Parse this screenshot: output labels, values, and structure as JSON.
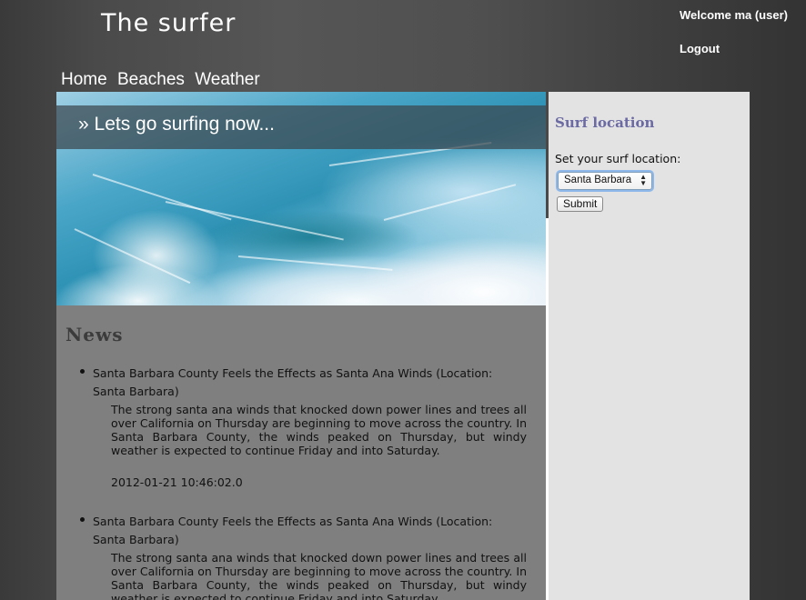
{
  "header": {
    "site_title": "The surfer",
    "welcome_text": "Welcome ma (user)",
    "logout_label": "Logout"
  },
  "nav": {
    "items": [
      {
        "label": "Home"
      },
      {
        "label": "Beaches"
      },
      {
        "label": "Weather"
      }
    ]
  },
  "hero": {
    "banner_text": "» Lets go surfing now..."
  },
  "news": {
    "heading": "News",
    "items": [
      {
        "headline": "Santa Barbara County Feels the Effects as Santa Ana Winds (Location: Santa Barbara)",
        "body": "The strong santa ana winds that knocked down power lines and trees all over California on Thursday are beginning to move across the country. In Santa Barbara County, the winds peaked on Thursday, but windy weather is expected to continue Friday and into Saturday.",
        "date": "2012-01-21 10:46:02.0"
      },
      {
        "headline": "Santa Barbara County Feels the Effects as Santa Ana Winds (Location: Santa Barbara)",
        "body": "The strong santa ana winds that knocked down power lines and trees all over California on Thursday are beginning to move across the country. In Santa Barbara County, the winds peaked on Thursday, but windy weather is expected to continue Friday and into Saturday.",
        "date": ""
      }
    ]
  },
  "sidebar": {
    "heading": "Surf location",
    "prompt": "Set your surf location:",
    "selected_location": "Santa Barbara",
    "submit_label": "Submit"
  },
  "colors": {
    "sidebar_heading": "#6b6aa3",
    "content_bg": "#7f7f7f",
    "sidebar_bg": "#e3e3e3"
  }
}
